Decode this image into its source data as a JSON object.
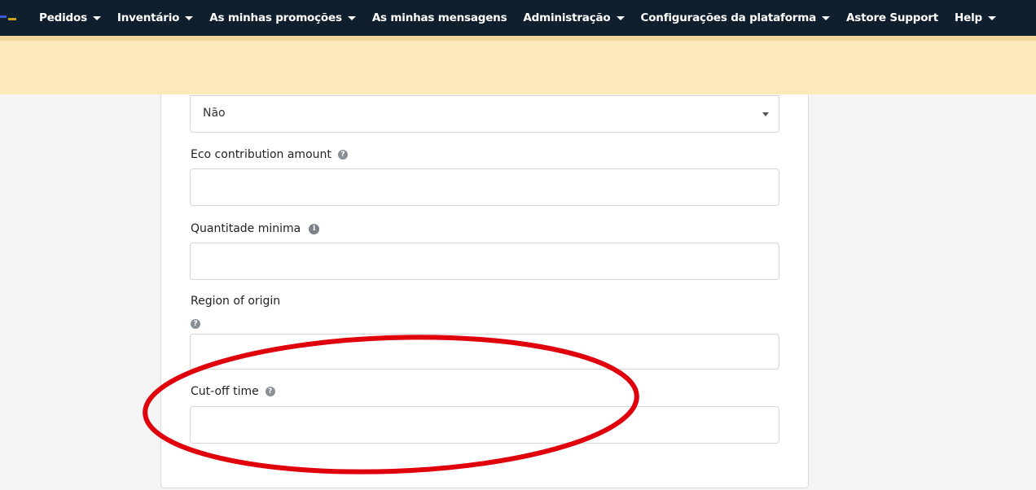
{
  "nav": {
    "items": [
      {
        "label": "Pedidos",
        "dropdown": true
      },
      {
        "label": "Inventário",
        "dropdown": true
      },
      {
        "label": "As minhas promoções",
        "dropdown": true
      },
      {
        "label": "As minhas mensagens",
        "dropdown": false
      },
      {
        "label": "Administração",
        "dropdown": true
      },
      {
        "label": "Configurações da plataforma",
        "dropdown": true
      },
      {
        "label": "Astore Support",
        "dropdown": false
      },
      {
        "label": "Help",
        "dropdown": true
      }
    ]
  },
  "form": {
    "select_value": "Não",
    "eco_label": "Eco contribution amount",
    "eco_value": "",
    "qty_label": "Quantitade minima",
    "qty_value": "",
    "region_label": "Region of origin",
    "region_value": "",
    "cutoff_label": "Cut-off time",
    "cutoff_value": ""
  },
  "icons": {
    "help": "question-circle-icon",
    "info": "info-circle-icon"
  },
  "colors": {
    "nav_bg": "#0f1f2e",
    "banner_bg": "#fde9ba",
    "annotation": "#e0000b"
  }
}
